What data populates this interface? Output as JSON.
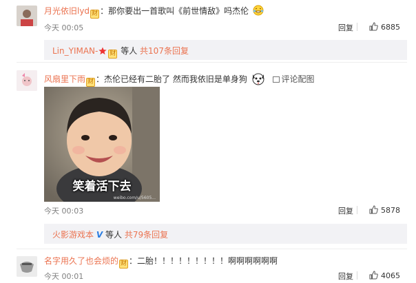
{
  "comments": [
    {
      "user": "月光依旧lyd",
      "badge": "财",
      "colon": "：",
      "text": "那你要出一首歌叫《前世情敌》吗杰伦",
      "emoji": "laughing-tears",
      "time": "今天 00:05",
      "reply": "回复",
      "likes": "6885",
      "sub": {
        "user": "Lin_YIMAN-",
        "badge": "财",
        "suffix": "等人",
        "count": "共107条回复"
      }
    },
    {
      "user": "风扇里下雨",
      "badge": "财",
      "colon": "：",
      "text": "杰伦已经有二胎了 然而我依旧是单身狗",
      "emoji": "dog-face",
      "pic_link": "评论配图",
      "image_caption": "笑着活下去",
      "image_watermark": "weibo.com/u/5605...",
      "time": "今天 00:03",
      "reply": "回复",
      "likes": "5878",
      "sub": {
        "user": "火影游戏本",
        "verified": "V",
        "suffix": "等人",
        "count": "共79条回复"
      }
    },
    {
      "user": "名字用久了也会烦的",
      "badge": "财",
      "colon": "：",
      "text": "二胎！！！！！！！！！啊啊啊啊啊啊",
      "time": "今天 00:01",
      "reply": "回复",
      "likes": "4065"
    }
  ],
  "colors": {
    "username": "#eb7350",
    "meta": "#808080",
    "subbox": "#f2f2f5"
  }
}
